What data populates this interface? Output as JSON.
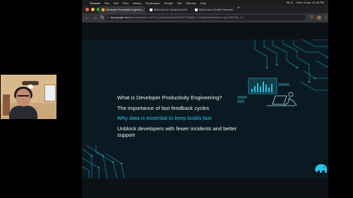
{
  "mac_menu": {
    "apple": "",
    "items": [
      "Chrome",
      "File",
      "Edit",
      "View",
      "History",
      "Bookmarks",
      "People",
      "Tab",
      "Window",
      "Help"
    ],
    "status": {
      "battery": "98 %",
      "datetime": "Wed 15 Apr 12:48 PM"
    }
  },
  "browser": {
    "tabs": [
      {
        "label": "Developer Productivity Engineer",
        "active": true
      },
      {
        "label": "Build scan for 'spring-boot-buil",
        "active": false
      },
      {
        "label": "Build scans | Gradle Enterprise",
        "active": false
      }
    ],
    "url_host": "docs.google.com",
    "url_path": "/presentation/d/1LJsWT1Z-phsUuP6YhBomBJG0YFXQd8Qn1_I9H0lyH4/edit#slide=id.g6123f07a8a_1_8"
  },
  "slide": {
    "agenda": [
      {
        "text": "What is Developer Productivity Engineering?",
        "highlight": false
      },
      {
        "text": "The importance of fast feedback cycles",
        "highlight": false
      },
      {
        "text": "Why data is essential to keep builds fast",
        "highlight": true
      },
      {
        "text": "Unblock developers with fewer incidents and better support",
        "highlight": false
      }
    ]
  },
  "colors": {
    "slide_bg": "#0b1a22",
    "accent": "#29c4e6",
    "circuit": "#1a9fb0"
  },
  "icons": [
    "elephant-logo-icon",
    "laptop-person-icon",
    "bar-chart-icon"
  ]
}
